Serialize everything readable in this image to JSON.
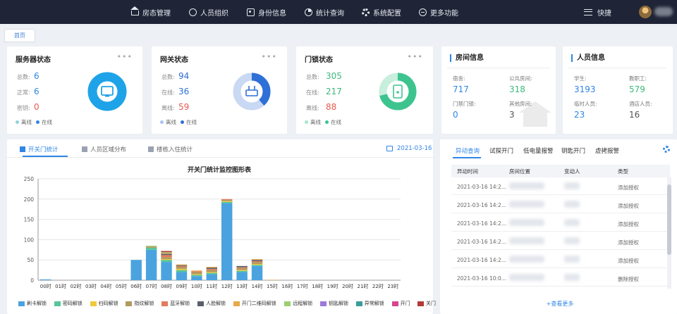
{
  "nav": {
    "items": [
      {
        "label": "房态管理",
        "icon": "home-icon"
      },
      {
        "label": "人员组织",
        "icon": "users-icon"
      },
      {
        "label": "身份信息",
        "icon": "id-card-icon"
      },
      {
        "label": "统计查询",
        "icon": "pie-chart-icon"
      },
      {
        "label": "系统配置",
        "icon": "gear-icon"
      },
      {
        "label": "更多功能",
        "icon": "more-icon"
      }
    ],
    "quick": "快捷"
  },
  "breadcrumb_tab": "首页",
  "server": {
    "title": "服务器状态",
    "rows": [
      {
        "label": "总数:",
        "value": "6"
      },
      {
        "label": "正常:",
        "value": "6"
      },
      {
        "label": "密钥:",
        "value": "0"
      }
    ],
    "legend": [
      "离线",
      "在线"
    ]
  },
  "gateway": {
    "title": "网关状态",
    "rows": [
      {
        "label": "总数:",
        "value": "94"
      },
      {
        "label": "在线:",
        "value": "36"
      },
      {
        "label": "离线:",
        "value": "59"
      }
    ],
    "legend": [
      "离线",
      "在线"
    ]
  },
  "lock": {
    "title": "门锁状态",
    "rows": [
      {
        "label": "总数:",
        "value": "305"
      },
      {
        "label": "在线:",
        "value": "217"
      },
      {
        "label": "离线:",
        "value": "88"
      }
    ],
    "legend": [
      "离线",
      "在线"
    ]
  },
  "room_info": {
    "title": "房间信息",
    "items": [
      {
        "label": "宿舍:",
        "value": "717"
      },
      {
        "label": "公共房间:",
        "value": "318"
      },
      {
        "label": "门禁门锁:",
        "value": "0"
      },
      {
        "label": "其他房间:",
        "value": "3"
      }
    ]
  },
  "person_info": {
    "title": "人员信息",
    "items": [
      {
        "label": "学生:",
        "value": "3193"
      },
      {
        "label": "教职工:",
        "value": "579"
      },
      {
        "label": "临时人员:",
        "value": "23"
      },
      {
        "label": "酒店人员:",
        "value": "16"
      }
    ]
  },
  "chart_tabs": [
    "开关门统计",
    "人员区域分布",
    "楼栋入住统计"
  ],
  "chart_date": "2021-03-16",
  "chart_data": {
    "type": "bar",
    "stacked": true,
    "title": "开关门统计监控图形表",
    "categories": [
      "00时",
      "01时",
      "02时",
      "03时",
      "04时",
      "05时",
      "06时",
      "07时",
      "08时",
      "09时",
      "10时",
      "11时",
      "12时",
      "13时",
      "14时",
      "15时",
      "16时",
      "17时",
      "18时",
      "19时",
      "20时",
      "21时",
      "22时",
      "23时"
    ],
    "ylim": [
      0,
      250
    ],
    "yticks": [
      0,
      50,
      100,
      150,
      200,
      250
    ],
    "grid": true,
    "legend_position": "bottom",
    "series": [
      {
        "name": "刷卡解锁",
        "color": "#4aa3df",
        "values": [
          2,
          0,
          0,
          0,
          0,
          0,
          50,
          75,
          45,
          20,
          10,
          15,
          190,
          20,
          35,
          0,
          0,
          0,
          0,
          0,
          0,
          0,
          0,
          0
        ]
      },
      {
        "name": "密码解锁",
        "color": "#56c59a",
        "values": [
          0,
          0,
          0,
          0,
          0,
          0,
          0,
          5,
          5,
          5,
          3,
          3,
          3,
          3,
          3,
          0,
          0,
          0,
          0,
          0,
          0,
          0,
          0,
          0
        ]
      },
      {
        "name": "扫码解锁",
        "color": "#f0c93d",
        "values": [
          0,
          0,
          0,
          0,
          0,
          0,
          0,
          0,
          2,
          3,
          2,
          2,
          2,
          2,
          2,
          0,
          0,
          0,
          0,
          0,
          0,
          0,
          0,
          0
        ]
      },
      {
        "name": "指纹解锁",
        "color": "#b2995f",
        "values": [
          0,
          0,
          0,
          0,
          0,
          0,
          0,
          3,
          5,
          5,
          5,
          5,
          3,
          5,
          5,
          0,
          0,
          0,
          0,
          0,
          0,
          0,
          0,
          0
        ]
      },
      {
        "name": "蓝牙解锁",
        "color": "#e07b5b",
        "values": [
          0,
          0,
          0,
          0,
          0,
          0,
          0,
          0,
          5,
          2,
          2,
          3,
          2,
          2,
          2,
          0,
          0,
          0,
          0,
          0,
          0,
          0,
          0,
          0
        ]
      },
      {
        "name": "人脸解锁",
        "color": "#5a5f69",
        "values": [
          0,
          0,
          0,
          0,
          0,
          0,
          0,
          0,
          3,
          2,
          0,
          3,
          0,
          3,
          3,
          0,
          0,
          0,
          0,
          0,
          0,
          0,
          0,
          0
        ]
      },
      {
        "name": "开门二维码解锁",
        "color": "#e8a94a",
        "values": [
          0,
          0,
          0,
          0,
          0,
          0,
          0,
          0,
          2,
          2,
          2,
          2,
          0,
          0,
          2,
          1,
          0,
          0,
          0,
          0,
          0,
          0,
          0,
          0
        ]
      },
      {
        "name": "远程解锁",
        "color": "#9ccf72",
        "values": [
          0,
          0,
          0,
          0,
          0,
          0,
          0,
          2,
          2,
          0,
          0,
          0,
          0,
          0,
          0,
          0,
          0,
          0,
          0,
          0,
          0,
          0,
          0,
          0
        ]
      },
      {
        "name": "钥匙解锁",
        "color": "#9b7ad8",
        "values": [
          0,
          0,
          0,
          0,
          0,
          0,
          0,
          0,
          0,
          0,
          0,
          0,
          0,
          0,
          0,
          0,
          0,
          0,
          0,
          0,
          0,
          0,
          0,
          0
        ]
      },
      {
        "name": "异常解锁",
        "color": "#3b9c9c",
        "values": [
          0,
          0,
          0,
          0,
          0,
          0,
          0,
          0,
          0,
          0,
          0,
          0,
          0,
          0,
          0,
          0,
          0,
          0,
          0,
          0,
          0,
          0,
          0,
          0
        ]
      },
      {
        "name": "开门",
        "color": "#d6458f",
        "values": [
          0,
          0,
          0,
          0,
          0,
          0,
          0,
          0,
          0,
          0,
          0,
          0,
          0,
          0,
          0,
          0,
          0,
          0,
          0,
          0,
          0,
          0,
          0,
          0
        ]
      },
      {
        "name": "关门",
        "color": "#b23a3a",
        "values": [
          0,
          0,
          0,
          0,
          0,
          0,
          0,
          0,
          3,
          0,
          0,
          0,
          0,
          0,
          0,
          0,
          0,
          0,
          0,
          0,
          0,
          0,
          0,
          0
        ]
      }
    ]
  },
  "alerts": {
    "tabs": [
      "异动查询",
      "试探开门",
      "低电量报警",
      "钥匙开门",
      "虚拷报警"
    ],
    "columns": [
      "异动时间",
      "房间位置",
      "变动人",
      "类型"
    ],
    "rows": [
      {
        "time": "2021-03-16 14:2...",
        "type": "添加授权"
      },
      {
        "time": "2021-03-16 14:2...",
        "type": "添加授权"
      },
      {
        "time": "2021-03-16 14:2...",
        "type": "添加授权"
      },
      {
        "time": "2021-03-16 14:2...",
        "type": "添加授权"
      },
      {
        "time": "2021-03-16 14:2...",
        "type": "添加授权"
      },
      {
        "time": "2021-03-16 10:0...",
        "type": "删除授权"
      }
    ],
    "more": "+查看更多"
  },
  "colors": {
    "accent": "#2f86e6",
    "server_ring": "#1fa3e8",
    "gateway_ring": "#2f6fd8",
    "lock_ring": "#3dc48e",
    "offline_dot": "#8fd3df",
    "online_dot": "#2f86e6",
    "red_value": "#e85a4f",
    "green_value": "#3dba7a"
  }
}
